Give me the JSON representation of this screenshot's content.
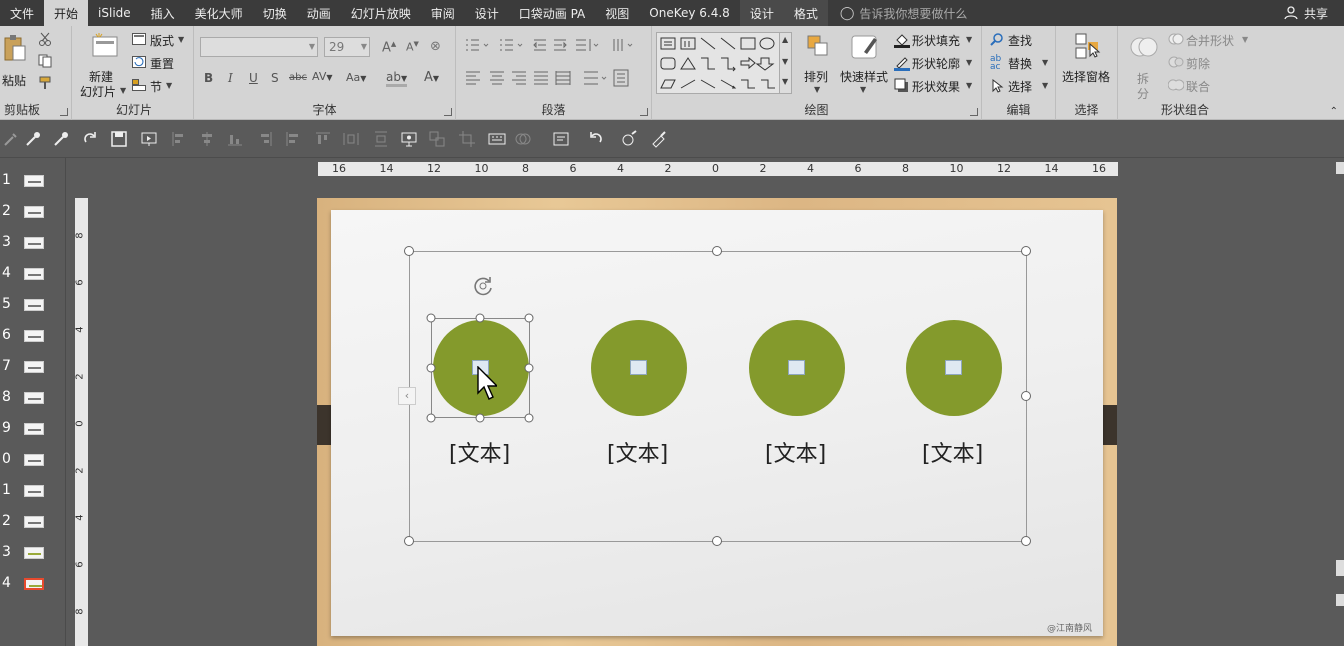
{
  "tabs": [
    "文件",
    "开始",
    "iSlide",
    "插入",
    "美化大师",
    "切换",
    "动画",
    "幻灯片放映",
    "审阅",
    "设计",
    "口袋动画 PA",
    "视图",
    "OneKey 6.4.8",
    "设计",
    "格式"
  ],
  "active_tab": "开始",
  "tell_me": "告诉我你想要做什么",
  "share": "共享",
  "ribbon": {
    "clipboard": {
      "paste": "粘贴",
      "label": "剪贴板"
    },
    "slides": {
      "new_slide_1": "新建",
      "new_slide_2": "幻灯片",
      "layout": "版式",
      "reset": "重置",
      "section": "节",
      "label": "幻灯片"
    },
    "font": {
      "font_name": "",
      "font_size": "29",
      "label": "字体"
    },
    "paragraph": {
      "label": "段落"
    },
    "drawing": {
      "arrange": "排列",
      "quick_styles": "快速样式",
      "shape_fill": "形状填充",
      "shape_outline": "形状轮廓",
      "shape_effects": "形状效果",
      "label": "绘图"
    },
    "editing": {
      "find": "查找",
      "replace": "替换",
      "select": "选择",
      "label": "编辑"
    },
    "select_group": {
      "selection_pane": "选择窗格",
      "label": "选择"
    },
    "shape_combine": {
      "split_1": "拆",
      "split_2": "分",
      "merge_shapes": "合并形状",
      "cut": "剪除",
      "union": "联合",
      "label": "形状组合"
    }
  },
  "thumbnails": [
    {
      "num": "1"
    },
    {
      "num": "2"
    },
    {
      "num": "3"
    },
    {
      "num": "4"
    },
    {
      "num": "5"
    },
    {
      "num": "6"
    },
    {
      "num": "7"
    },
    {
      "num": "8"
    },
    {
      "num": "9"
    },
    {
      "num": "0"
    },
    {
      "num": "1"
    },
    {
      "num": "2"
    },
    {
      "num": "3"
    },
    {
      "num": "4"
    }
  ],
  "selected_thumbnail_index": 13,
  "h_ruler": [
    "16",
    "14",
    "12",
    "10",
    "8",
    "6",
    "4",
    "2",
    "0",
    "2",
    "4",
    "6",
    "8",
    "10",
    "12",
    "14",
    "16"
  ],
  "v_ruler": [
    "8",
    "6",
    "4",
    "2",
    "0",
    "2",
    "4",
    "6",
    "8"
  ],
  "slide": {
    "captions": [
      "[文本]",
      "[文本]",
      "[文本]",
      "[文本]"
    ],
    "circle_color": "#849a2c",
    "watermark": "@江南静风"
  }
}
